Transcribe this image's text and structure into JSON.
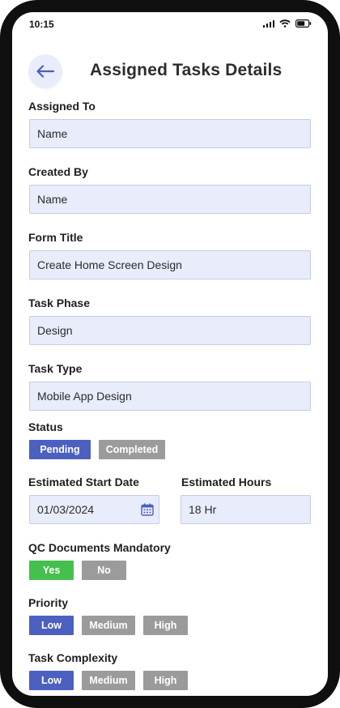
{
  "status_bar": {
    "time": "10:15"
  },
  "header": {
    "title": "Assigned Tasks Details"
  },
  "form": {
    "assigned_to": {
      "label": "Assigned To",
      "value": "Name"
    },
    "created_by": {
      "label": "Created By",
      "value": "Name"
    },
    "form_title": {
      "label": "Form Title",
      "value": "Create Home Screen Design"
    },
    "task_phase": {
      "label": "Task Phase",
      "value": "Design"
    },
    "task_type": {
      "label": "Task Type",
      "value": "Mobile App Design"
    },
    "status": {
      "label": "Status",
      "options": [
        "Pending",
        "Completed"
      ],
      "selected": "Pending"
    },
    "start_date": {
      "label": "Estimated Start Date",
      "value": "01/03/2024"
    },
    "hours": {
      "label": "Estimated Hours",
      "value": "18 Hr"
    },
    "qc_docs": {
      "label": "QC Documents Mandatory",
      "options": [
        "Yes",
        "No"
      ],
      "selected": "Yes"
    },
    "priority": {
      "label": "Priority",
      "options": [
        "Low",
        "Medium",
        "High"
      ],
      "selected": "Low"
    },
    "complexity": {
      "label": "Task Complexity",
      "options": [
        "Low",
        "Medium",
        "High"
      ],
      "selected": "Low"
    }
  },
  "colors": {
    "accent": "#4c60c0",
    "unselected": "#9b9b9b",
    "yes_selected": "#45c04c",
    "field_bg": "#e8ecfb"
  },
  "icons": [
    "signal-icon",
    "wifi-icon",
    "battery-icon",
    "back-arrow-icon",
    "calendar-icon"
  ]
}
